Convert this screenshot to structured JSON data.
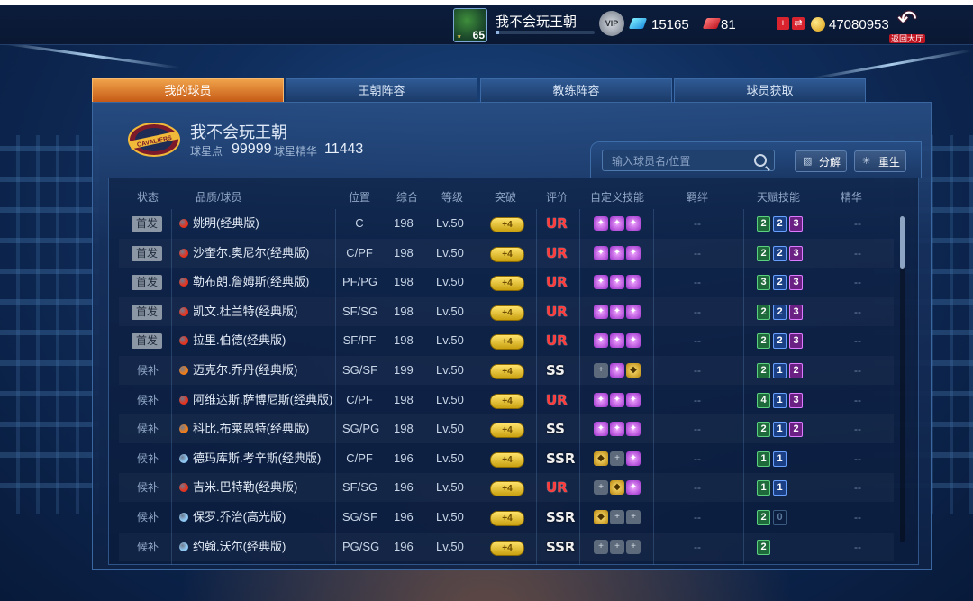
{
  "header": {
    "player_name": "我不会玩王朝",
    "level": "65",
    "vip_label": "VIP",
    "diamonds": "15165",
    "tickets": "81",
    "gold": "47080953",
    "back_label": "返回大厅"
  },
  "tabs": [
    {
      "label": "我的球员",
      "active": true
    },
    {
      "label": "王朝阵容",
      "active": false
    },
    {
      "label": "教练阵容",
      "active": false
    },
    {
      "label": "球员获取",
      "active": false
    }
  ],
  "team": {
    "name": "我不会玩王朝",
    "star_points_label": "球星点",
    "star_points": "99999",
    "essence_label": "球星精华",
    "essence": "11443"
  },
  "search": {
    "placeholder": "输入球员名/位置"
  },
  "buttons": {
    "decompose": "分解",
    "rebirth": "重生"
  },
  "columns": [
    "状态",
    "品质/球员",
    "位置",
    "综合",
    "等级",
    "突破",
    "评价",
    "自定义技能",
    "羁绊",
    "天赋技能",
    "精华"
  ],
  "players": [
    {
      "status": "首发",
      "starter": true,
      "quality": "red",
      "name": "姚明(经典版)",
      "pos": "C",
      "ovr": "198",
      "lv": "Lv.50",
      "brk": "+4",
      "grade": "UR",
      "skills": [
        "purple",
        "purple",
        "purple"
      ],
      "bond": "--",
      "talents": [
        [
          "2",
          "g"
        ],
        [
          "2",
          "b"
        ],
        [
          "3",
          "p"
        ]
      ],
      "ess": "--"
    },
    {
      "status": "首发",
      "starter": true,
      "quality": "red",
      "name": "沙奎尔.奥尼尔(经典版)",
      "pos": "C/PF",
      "ovr": "198",
      "lv": "Lv.50",
      "brk": "+4",
      "grade": "UR",
      "skills": [
        "purple",
        "purple",
        "purple"
      ],
      "bond": "--",
      "talents": [
        [
          "2",
          "g"
        ],
        [
          "2",
          "b"
        ],
        [
          "3",
          "p"
        ]
      ],
      "ess": "--"
    },
    {
      "status": "首发",
      "starter": true,
      "quality": "red",
      "name": "勒布朗.詹姆斯(经典版)",
      "pos": "PF/PG",
      "ovr": "198",
      "lv": "Lv.50",
      "brk": "+4",
      "grade": "UR",
      "skills": [
        "purple",
        "purple",
        "purple"
      ],
      "bond": "--",
      "talents": [
        [
          "3",
          "g"
        ],
        [
          "2",
          "b"
        ],
        [
          "3",
          "p"
        ]
      ],
      "ess": "--"
    },
    {
      "status": "首发",
      "starter": true,
      "quality": "red",
      "name": "凯文.杜兰特(经典版)",
      "pos": "SF/SG",
      "ovr": "198",
      "lv": "Lv.50",
      "brk": "+4",
      "grade": "UR",
      "skills": [
        "purple",
        "purple",
        "purple"
      ],
      "bond": "--",
      "talents": [
        [
          "2",
          "g"
        ],
        [
          "2",
          "b"
        ],
        [
          "3",
          "p"
        ]
      ],
      "ess": "--"
    },
    {
      "status": "首发",
      "starter": true,
      "quality": "red",
      "name": "拉里.伯德(经典版)",
      "pos": "SF/PF",
      "ovr": "198",
      "lv": "Lv.50",
      "brk": "+4",
      "grade": "UR",
      "skills": [
        "purple",
        "purple",
        "purple"
      ],
      "bond": "--",
      "talents": [
        [
          "2",
          "g"
        ],
        [
          "2",
          "b"
        ],
        [
          "3",
          "p"
        ]
      ],
      "ess": "--"
    },
    {
      "status": "候补",
      "starter": false,
      "quality": "orange",
      "name": "迈克尔.乔丹(经典版)",
      "pos": "SG/SF",
      "ovr": "199",
      "lv": "Lv.50",
      "brk": "+4",
      "grade": "SS",
      "skills": [
        "empty",
        "purple",
        "gold"
      ],
      "bond": "--",
      "talents": [
        [
          "2",
          "g"
        ],
        [
          "1",
          "b"
        ],
        [
          "2",
          "p"
        ]
      ],
      "ess": "--"
    },
    {
      "status": "候补",
      "starter": false,
      "quality": "red",
      "name": "阿维达斯.萨博尼斯(经典版)",
      "pos": "C/PF",
      "ovr": "198",
      "lv": "Lv.50",
      "brk": "+4",
      "grade": "UR",
      "skills": [
        "purple",
        "purple",
        "purple"
      ],
      "bond": "--",
      "talents": [
        [
          "4",
          "g"
        ],
        [
          "1",
          "b"
        ],
        [
          "3",
          "p"
        ]
      ],
      "ess": "--"
    },
    {
      "status": "候补",
      "starter": false,
      "quality": "orange",
      "name": "科比.布莱恩特(经典版)",
      "pos": "SG/PG",
      "ovr": "198",
      "lv": "Lv.50",
      "brk": "+4",
      "grade": "SS",
      "skills": [
        "purple",
        "purple",
        "purple"
      ],
      "bond": "--",
      "talents": [
        [
          "2",
          "g"
        ],
        [
          "1",
          "b"
        ],
        [
          "2",
          "p"
        ]
      ],
      "ess": "--"
    },
    {
      "status": "候补",
      "starter": false,
      "quality": "blue",
      "name": "德玛库斯.考辛斯(经典版)",
      "pos": "C/PF",
      "ovr": "196",
      "lv": "Lv.50",
      "brk": "+4",
      "grade": "SSR",
      "skills": [
        "gold",
        "empty",
        "purple"
      ],
      "bond": "--",
      "talents": [
        [
          "1",
          "g"
        ],
        [
          "1",
          "b"
        ]
      ],
      "ess": "--"
    },
    {
      "status": "候补",
      "starter": false,
      "quality": "red",
      "name": "吉米.巴特勒(经典版)",
      "pos": "SF/SG",
      "ovr": "196",
      "lv": "Lv.50",
      "brk": "+4",
      "grade": "UR",
      "skills": [
        "empty",
        "gold",
        "purple"
      ],
      "bond": "--",
      "talents": [
        [
          "1",
          "g"
        ],
        [
          "1",
          "b"
        ]
      ],
      "ess": "--"
    },
    {
      "status": "候补",
      "starter": false,
      "quality": "blue",
      "name": "保罗.乔治(高光版)",
      "pos": "SG/SF",
      "ovr": "196",
      "lv": "Lv.50",
      "brk": "+4",
      "grade": "SSR",
      "skills": [
        "gold",
        "empty",
        "empty"
      ],
      "bond": "--",
      "talents": [
        [
          "2",
          "g"
        ],
        [
          "0",
          "off"
        ]
      ],
      "ess": "--"
    },
    {
      "status": "候补",
      "starter": false,
      "quality": "blue",
      "name": "约翰.沃尔(经典版)",
      "pos": "PG/SG",
      "ovr": "196",
      "lv": "Lv.50",
      "brk": "+4",
      "grade": "SSR",
      "skills": [
        "empty",
        "empty",
        "empty"
      ],
      "bond": "--",
      "talents": [
        [
          "2",
          "g"
        ]
      ],
      "ess": "--"
    }
  ],
  "colors": {
    "red": "#e5341f",
    "orange": "#ef7d1a",
    "blue": "#8ec7f2"
  }
}
